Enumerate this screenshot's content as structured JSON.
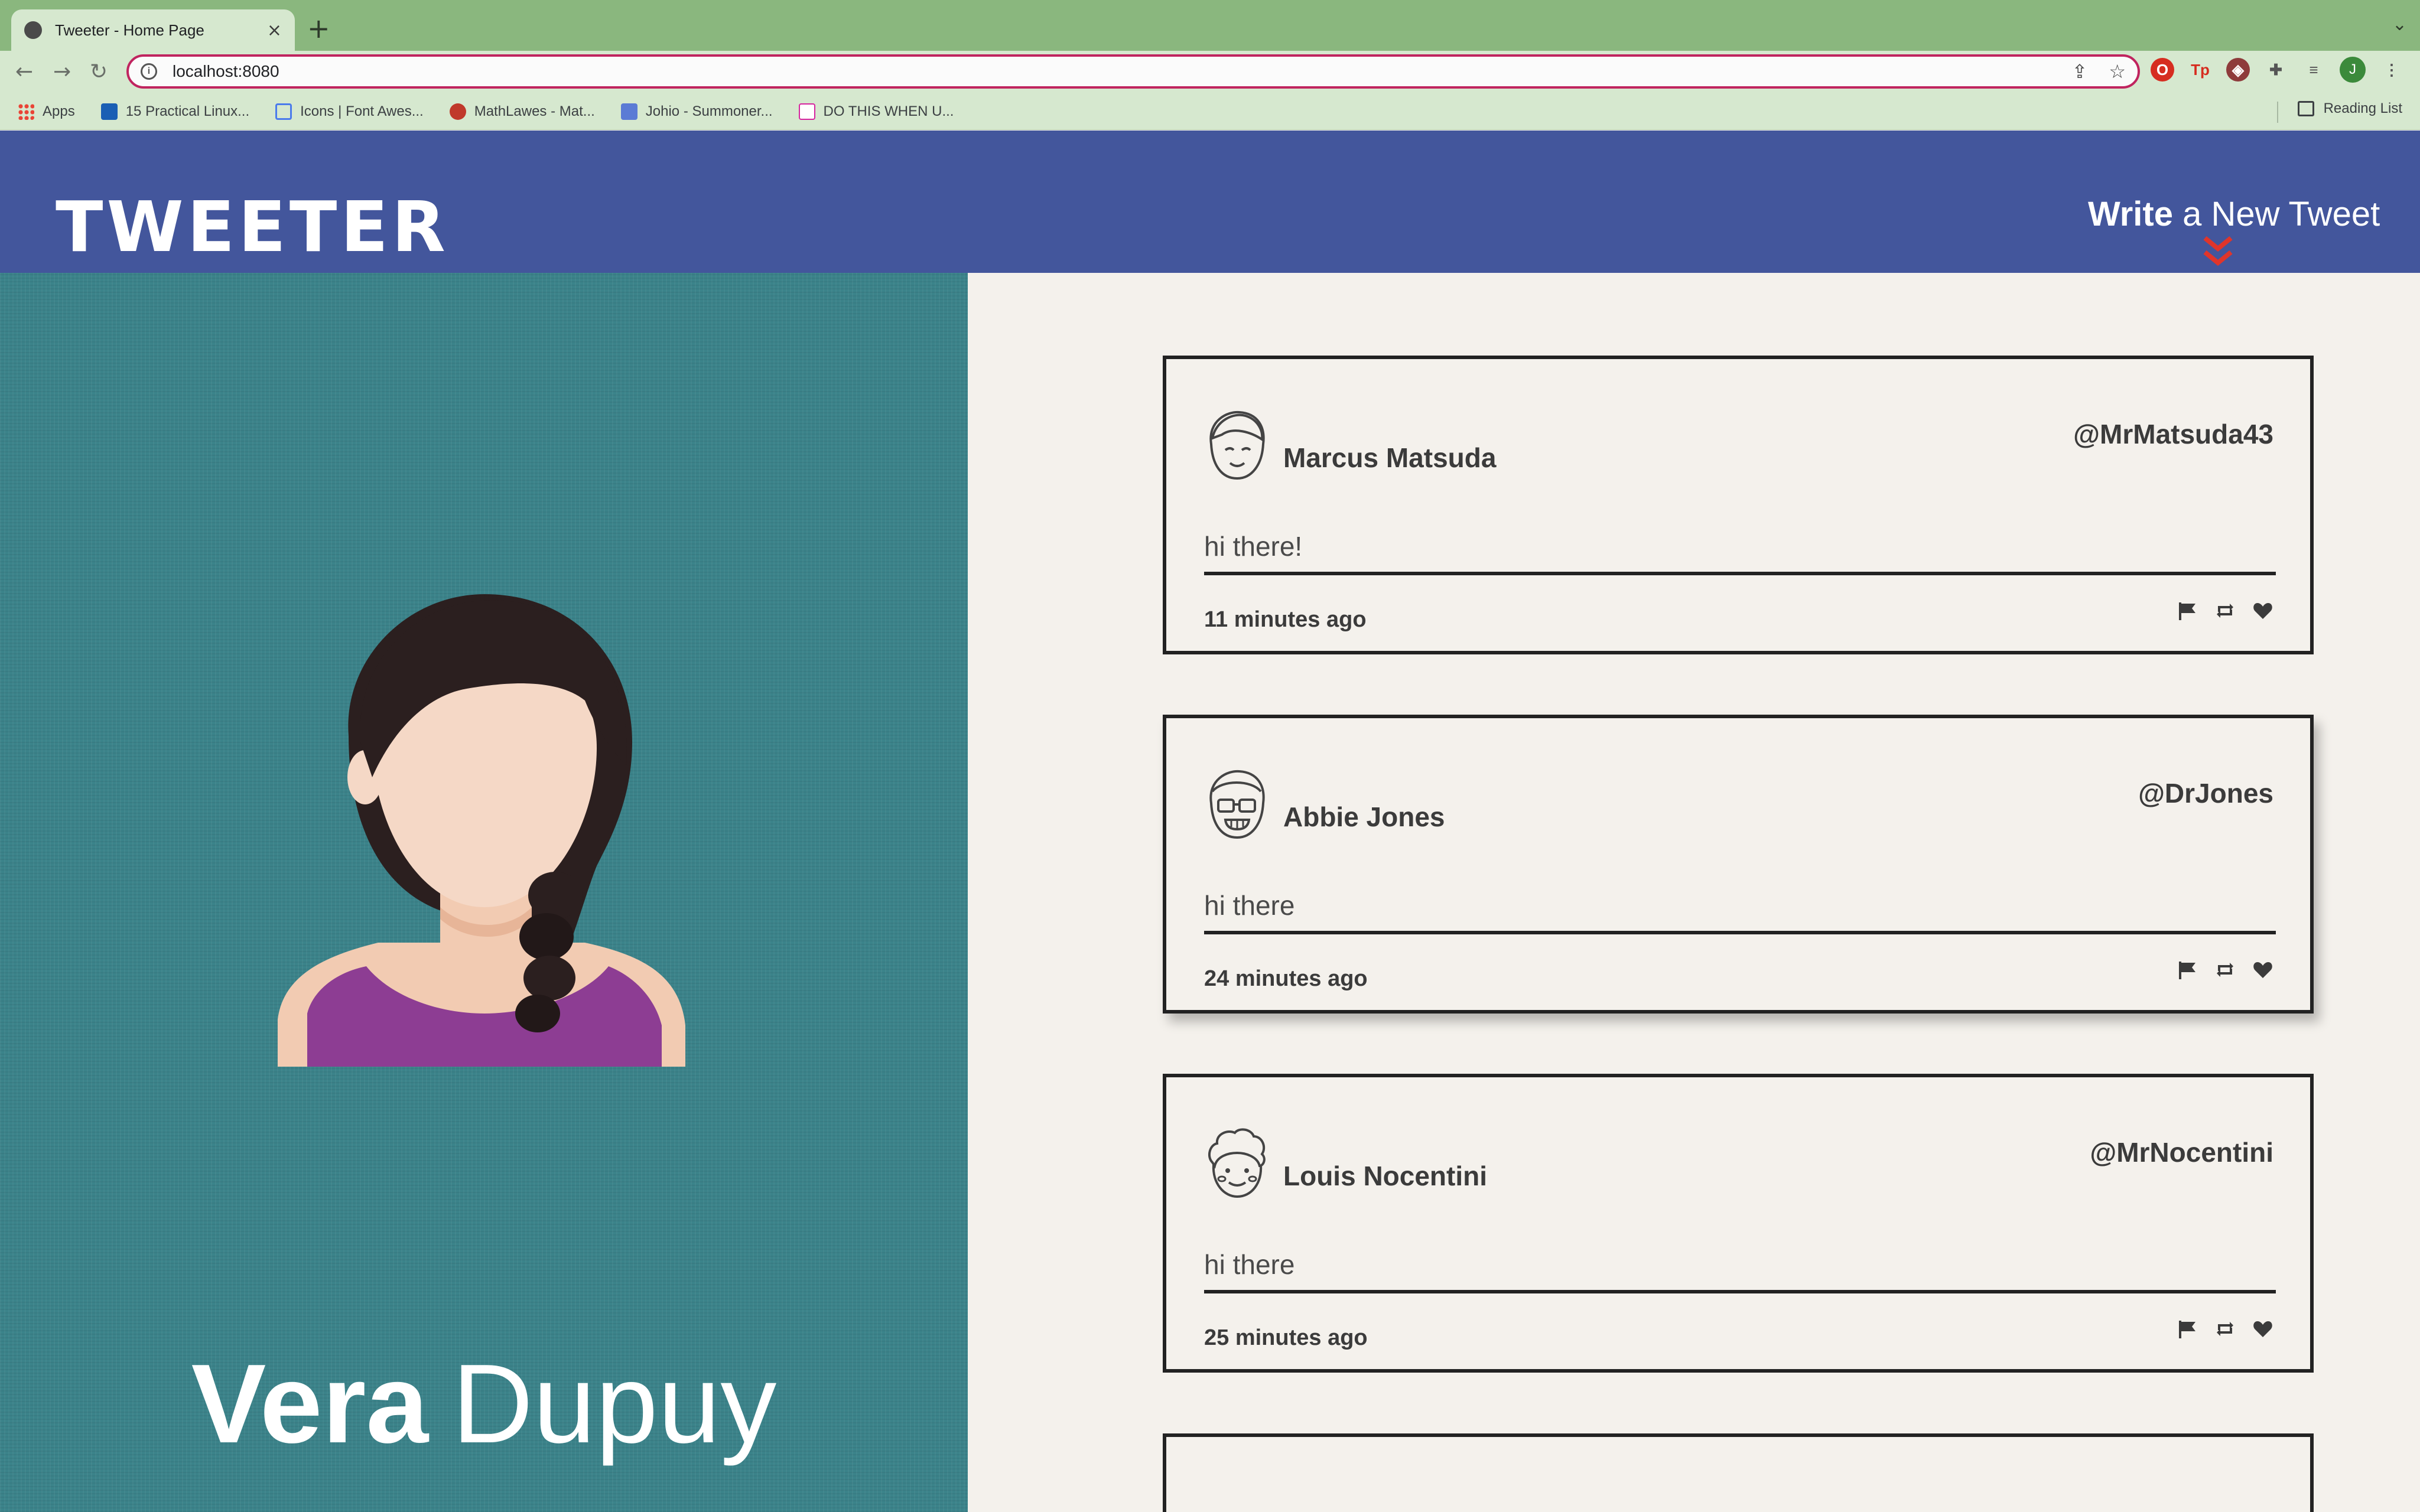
{
  "browser": {
    "tab_title": "Tweeter - Home Page",
    "tab_close": "×",
    "new_tab": "+",
    "url": "localhost:8080",
    "profile_initial": "J",
    "bookmarks": [
      {
        "label": "Apps",
        "icon": "apps-grid-icon",
        "color": "#e8710a"
      },
      {
        "label": "15 Practical Linux...",
        "icon": "site-favicon",
        "color": "#1a5fb4"
      },
      {
        "label": "Icons | Font Awes...",
        "icon": "flag-favicon",
        "color": "#4b7bec"
      },
      {
        "label": "MathLawes - Mat...",
        "icon": "site-favicon",
        "color": "#c0392b"
      },
      {
        "label": "Johio - Summoner...",
        "icon": "site-favicon",
        "color": "#5b7bd5"
      },
      {
        "label": "DO THIS WHEN U...",
        "icon": "site-favicon",
        "color": "#d6249f"
      }
    ],
    "reading_list": "Reading List"
  },
  "header": {
    "logo": "TWEETER",
    "compose_bold": "Write",
    "compose_rest": "a New Tweet",
    "accent_color": "#e0352b"
  },
  "profile": {
    "first_name": "Vera",
    "last_name": "Dupuy"
  },
  "tweets": [
    {
      "name": "Marcus Matsuda",
      "handle": "@MrMatsuda43",
      "text": "hi there!",
      "time": "11 minutes ago",
      "avatar": "smiling-face-icon"
    },
    {
      "name": "Abbie Jones",
      "handle": "@DrJones",
      "text": "hi there",
      "time": "24 minutes ago",
      "avatar": "glasses-face-icon"
    },
    {
      "name": "Louis Nocentini",
      "handle": "@MrNocentini",
      "text": "hi there",
      "time": "25 minutes ago",
      "avatar": "curly-hair-face-icon"
    }
  ],
  "colors": {
    "header_bg": "#43569c",
    "profile_bg": "#3b838a",
    "feed_bg": "#f4f1ec"
  }
}
